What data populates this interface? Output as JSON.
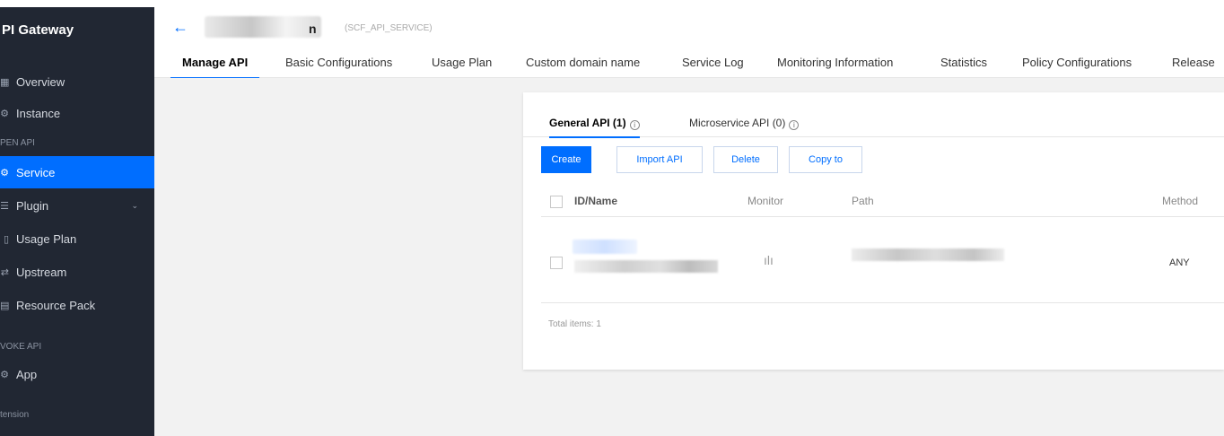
{
  "sidebar": {
    "title": "PI Gateway",
    "items": [
      {
        "icon": "overview-icon",
        "glyph": "▦",
        "label": "Overview"
      },
      {
        "icon": "instance-icon",
        "glyph": "⚙",
        "label": "Instance"
      },
      {
        "icon": "service-icon",
        "glyph": "⚙",
        "label": "Service"
      },
      {
        "icon": "plugin-icon",
        "glyph": "☰",
        "label": "Plugin"
      },
      {
        "icon": "usage-plan-icon",
        "glyph": "▯",
        "label": "Usage Plan"
      },
      {
        "icon": "upstream-icon",
        "glyph": "⇄",
        "label": "Upstream"
      },
      {
        "icon": "resource-pack-icon",
        "glyph": "▤",
        "label": "Resource Pack"
      },
      {
        "icon": "app-icon",
        "glyph": "⚙",
        "label": "App"
      }
    ],
    "groups": [
      "PEN API",
      "VOKE API",
      "tension"
    ],
    "plugin_chevron": "⌄"
  },
  "header": {
    "back": "←",
    "service_name_tail": "n",
    "service_id": "(SCF_API_SERVICE)"
  },
  "tabs": [
    "Manage API",
    "Basic Configurations",
    "Usage Plan",
    "Custom domain name",
    "Service Log",
    "Monitoring Information",
    "Statistics",
    "Policy Configurations",
    "Release"
  ],
  "subtabs": [
    {
      "label": "General API (1)",
      "info": "i"
    },
    {
      "label": "Microservice API (0)",
      "info": "i"
    }
  ],
  "buttons": {
    "create": "Create",
    "import": "Import API",
    "delete": "Delete",
    "copy": "Copy to"
  },
  "table": {
    "columns": [
      "ID/Name",
      "Monitor",
      "Path",
      "Method"
    ],
    "rows": [
      {
        "method": "ANY",
        "monitor_icon": "monitor-chart-icon",
        "monitor_glyph": "ılı"
      }
    ]
  },
  "footer": {
    "total": "Total items: 1"
  },
  "colors": {
    "accent": "#006eff",
    "sidebar_bg": "#212733"
  }
}
